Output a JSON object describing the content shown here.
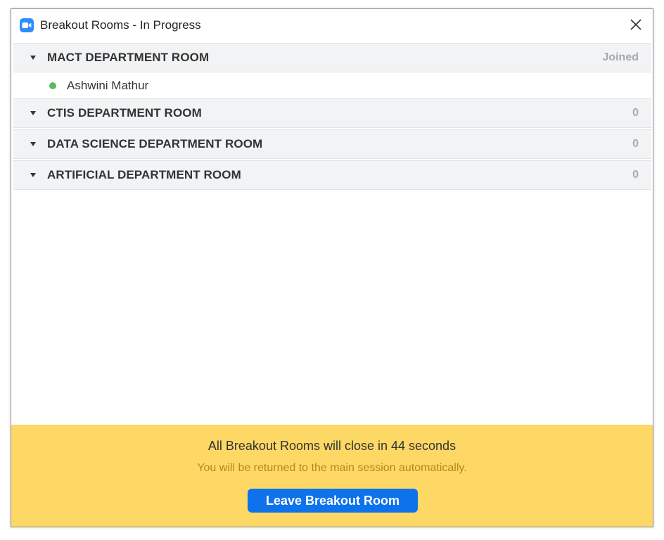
{
  "window": {
    "title": "Breakout Rooms - In Progress"
  },
  "icons": {
    "app": "zoom-camera-icon",
    "close": "close-icon",
    "caret": "caret-down-icon",
    "presence": "online-status-dot"
  },
  "rooms": [
    {
      "name": "MACT DEPARTMENT ROOM",
      "status": "Joined",
      "participants": [
        {
          "name": "Ashwini Mathur"
        }
      ]
    },
    {
      "name": "CTIS DEPARTMENT ROOM",
      "status": "0",
      "participants": []
    },
    {
      "name": "DATA SCIENCE DEPARTMENT ROOM",
      "status": "0",
      "participants": []
    },
    {
      "name": "ARTIFICIAL DEPARTMENT ROOM",
      "status": "0",
      "participants": []
    }
  ],
  "footer": {
    "message": "All Breakout Rooms will close in 44 seconds",
    "submessage": "You will be returned to the main session automatically.",
    "leave_button": "Leave Breakout Room"
  },
  "colors": {
    "accent": "#0e72ed",
    "banner": "#fdd865",
    "online": "#5fb962",
    "status_text": "#a7a9ac"
  }
}
